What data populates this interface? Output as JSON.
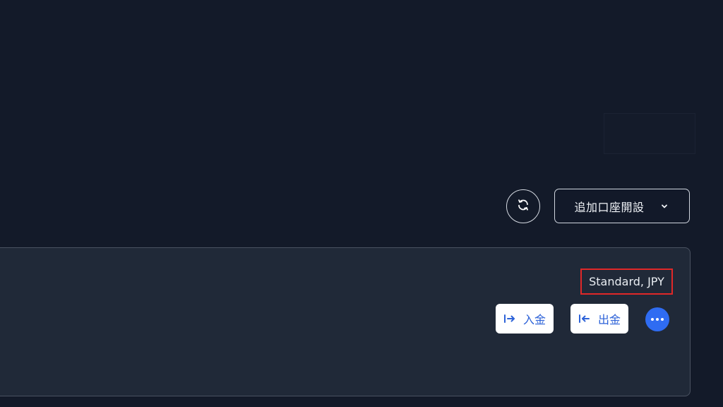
{
  "toolbar": {
    "add_account_label": "追加口座開設"
  },
  "account": {
    "type_label": "Standard, JPY",
    "deposit_label": "入金",
    "withdraw_label": "出金"
  },
  "icons": {
    "refresh": "refresh-icon",
    "chevron": "chevron-down-icon",
    "deposit": "deposit-arrow-icon",
    "withdraw": "withdraw-arrow-icon",
    "more": "more-dots-icon"
  },
  "colors": {
    "background": "#131a29",
    "card": "#202938",
    "accent": "#2f6cf2",
    "highlight": "#e02828"
  }
}
